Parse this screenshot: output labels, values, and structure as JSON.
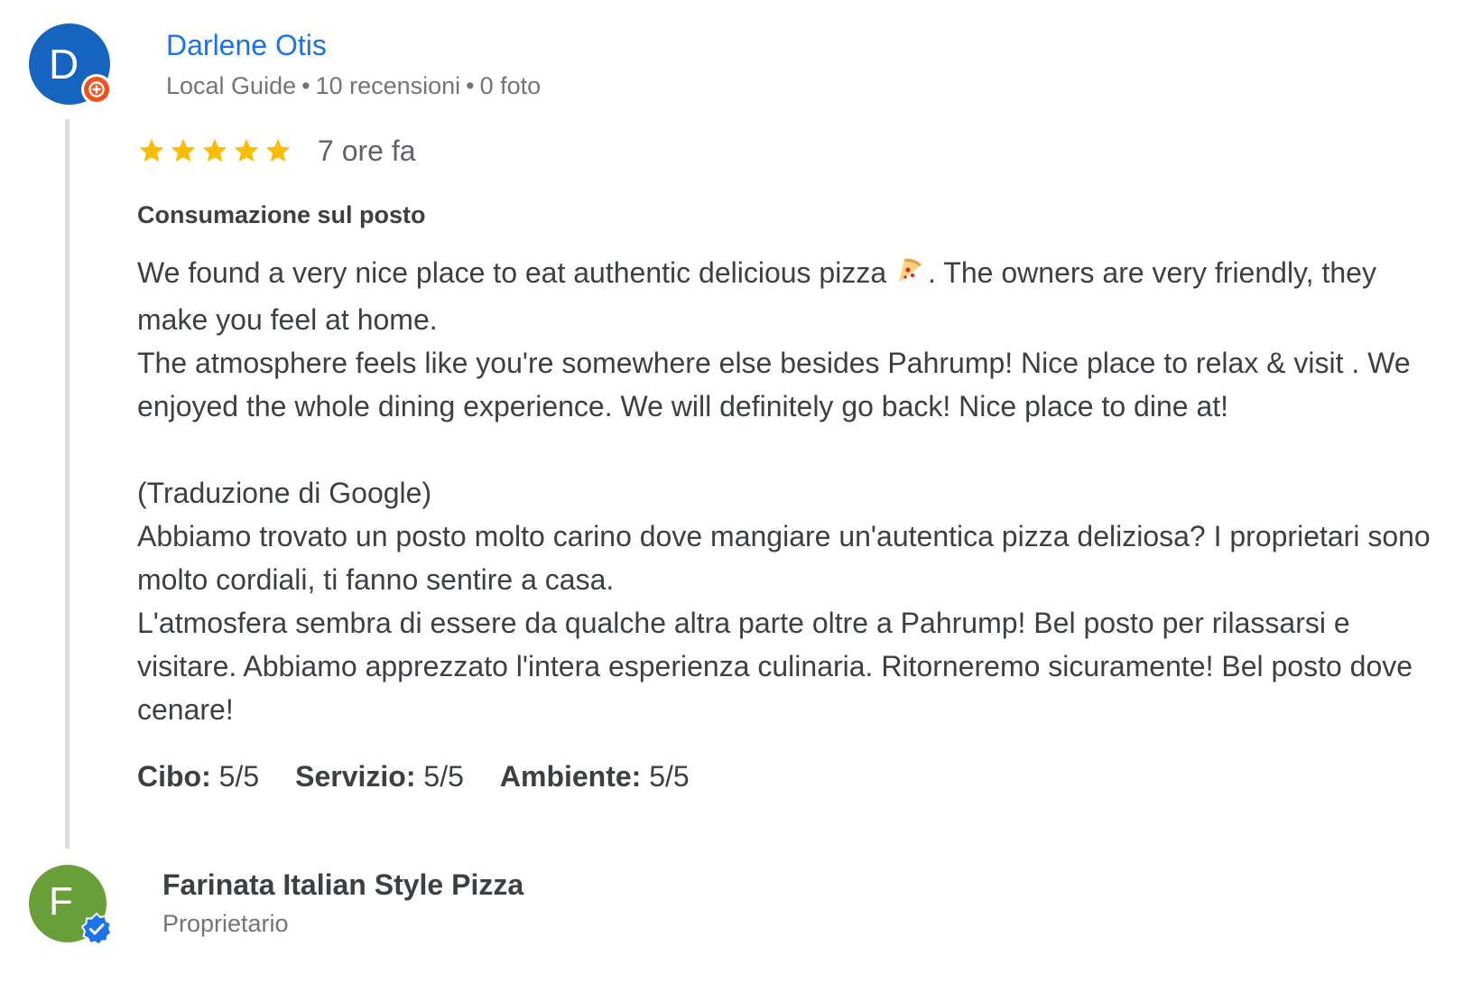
{
  "reviewer": {
    "initial": "D",
    "name": "Darlene Otis",
    "badge": "Local Guide",
    "reviews_count": "10 recensioni",
    "photos_count": "0 foto",
    "separator": "•",
    "avatar_color": "#1565c0",
    "badge_color": "#f4511e"
  },
  "review": {
    "stars": 5,
    "star_color": "#fbbc04",
    "time_ago": "7 ore fa",
    "service_type": "Consumazione sul posto",
    "text_part1": "We found a very nice place to eat authentic delicious pizza",
    "emoji": "pizza-icon",
    "text_part2": ". The owners are very friendly, they make you feel at home.\nThe atmosphere feels like you're somewhere else besides Pahrump! Nice place to relax & visit . We enjoyed the whole dining experience. We will definitely go back! Nice place to dine at!\n\n(Traduzione di Google)\nAbbiamo trovato un posto molto carino dove mangiare un'autentica pizza deliziosa? I proprietari sono molto cordiali, ti fanno sentire a casa.\nL'atmosfera sembra di essere da qualche altra parte oltre a Pahrump! Bel posto per rilassarsi e visitare. Abbiamo apprezzato l'intera esperienza culinaria. Ritorneremo sicuramente! Bel posto dove cenare!",
    "scores": [
      {
        "label": "Cibo:",
        "value": "5/5"
      },
      {
        "label": "Servizio:",
        "value": "5/5"
      },
      {
        "label": "Ambiente:",
        "value": "5/5"
      }
    ]
  },
  "owner": {
    "initial": "F",
    "name": "Farinata Italian Style Pizza",
    "role": "Proprietario",
    "avatar_color": "#689f38",
    "verified_color": "#1a73e8"
  }
}
